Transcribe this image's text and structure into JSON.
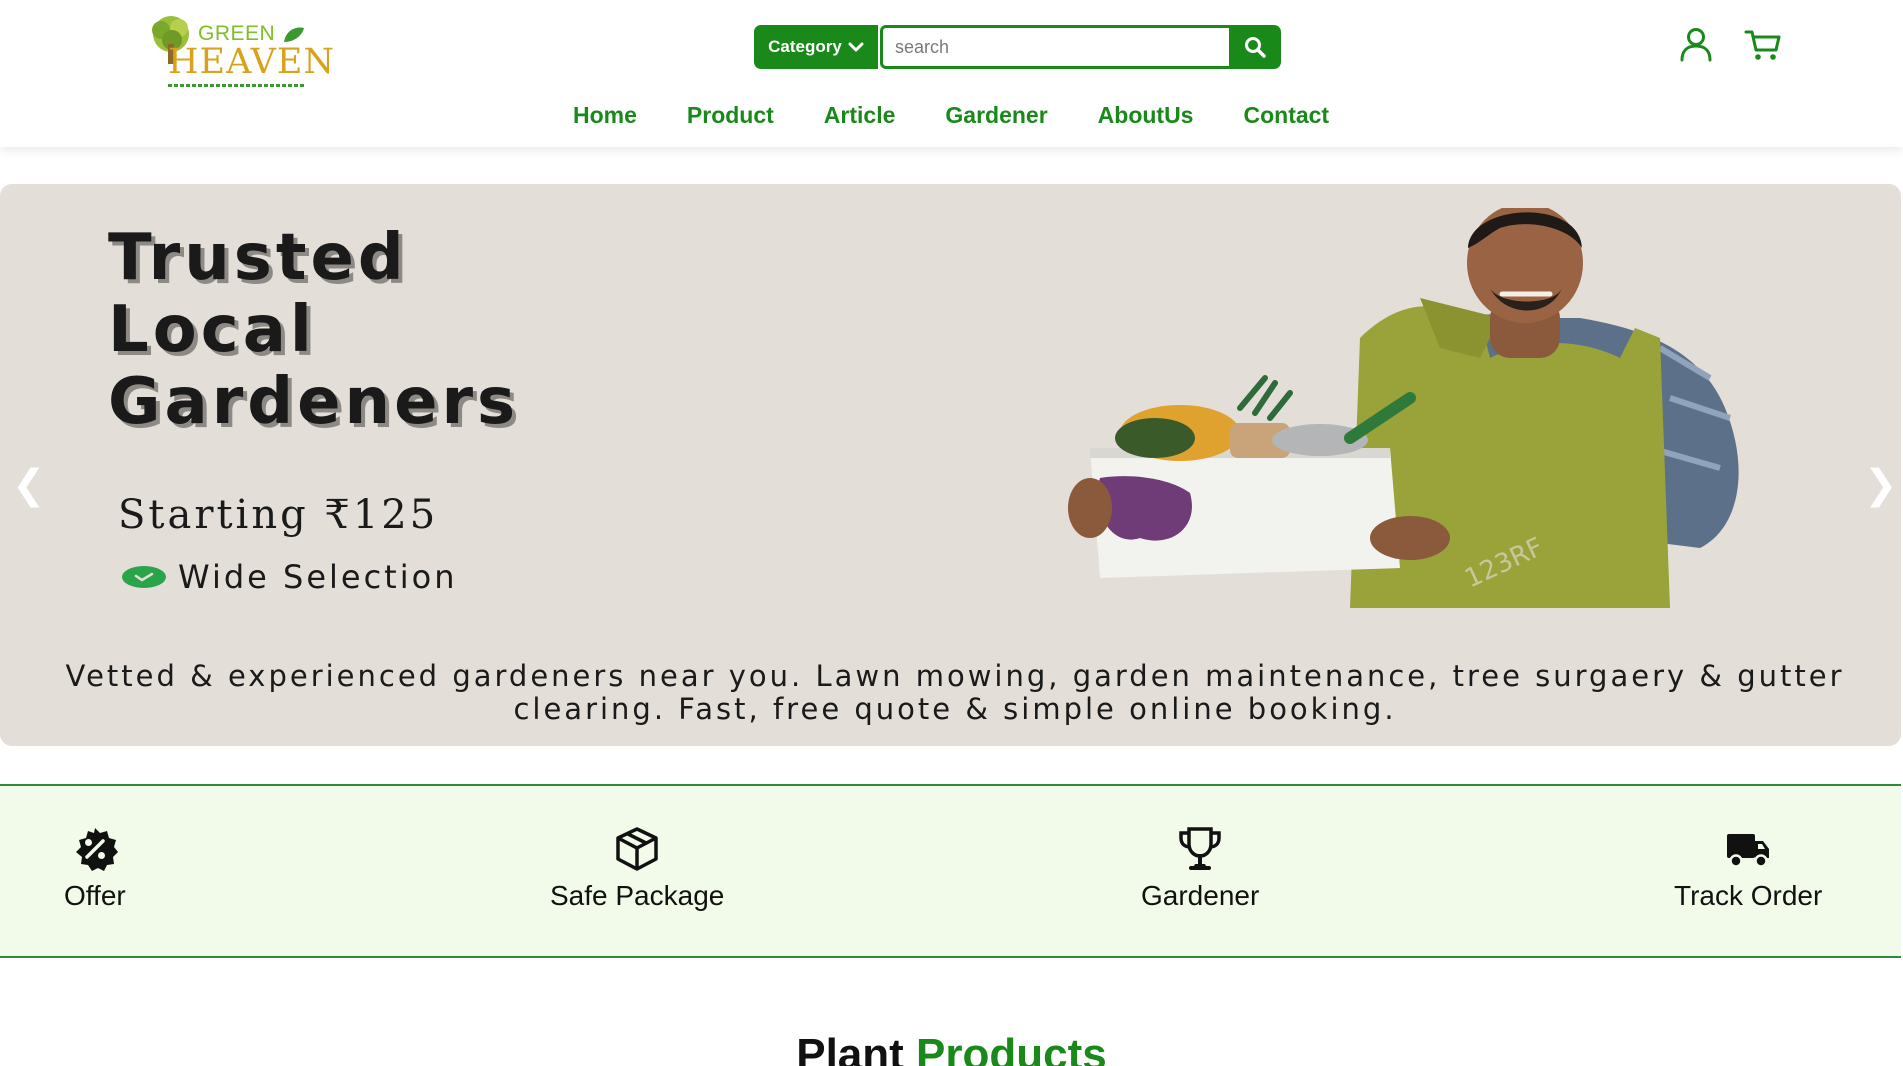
{
  "header": {
    "logo": {
      "line1": "GREEN",
      "line2": "HEAVEN"
    },
    "category_label": "Category",
    "search": {
      "placeholder": "search"
    },
    "icons": {
      "search": "search-icon",
      "user": "user-icon",
      "cart": "cart-icon"
    }
  },
  "nav": {
    "items": [
      {
        "label": "Home"
      },
      {
        "label": "Product"
      },
      {
        "label": "Article"
      },
      {
        "label": "Gardener"
      },
      {
        "label": "AboutUs"
      },
      {
        "label": "Contact"
      }
    ]
  },
  "hero": {
    "title_line1": "Trusted",
    "title_line2": "Local",
    "title_line3": "Gardeners",
    "price_text": "Starting ₹125",
    "feature_text": "Wide Selection",
    "description": "Vetted & experienced gardeners near you. Lawn mowing, garden maintenance, tree surgaery & gutter clearing. Fast, free quote & simple online booking.",
    "prev_arrow": "❮",
    "next_arrow": "❯",
    "watermark": "123RF"
  },
  "features": [
    {
      "label": "Offer",
      "icon": "discount-badge-icon"
    },
    {
      "label": "Safe Package",
      "icon": "package-icon"
    },
    {
      "label": "Gardener",
      "icon": "trophy-icon"
    },
    {
      "label": "Track Order",
      "icon": "truck-icon"
    }
  ],
  "section": {
    "title_part1": "Plant",
    "title_part2": "Products"
  },
  "colors": {
    "brand_green": "#198a1a",
    "hero_bg": "#e3ded8",
    "feature_strip_bg": "#f2fbe9"
  }
}
